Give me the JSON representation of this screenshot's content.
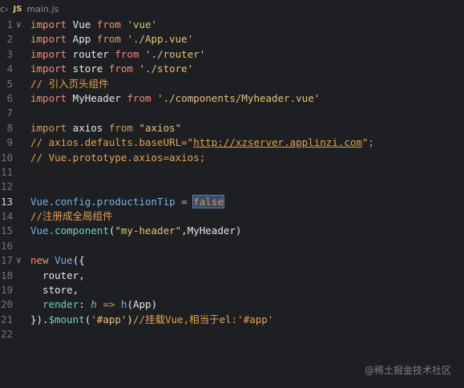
{
  "breadcrumb": {
    "prefix": "c",
    "separator": "›",
    "file_icon": "JS",
    "file_name": "main.js"
  },
  "lines": [
    {
      "n": "1",
      "fold": "∨",
      "parts": [
        [
          "kw",
          "import"
        ],
        [
          "id",
          " Vue "
        ],
        [
          "kw",
          "from"
        ],
        [
          "id",
          " "
        ],
        [
          "str",
          "'vue'"
        ]
      ]
    },
    {
      "n": "2",
      "parts": [
        [
          "kw",
          "import"
        ],
        [
          "id",
          " App "
        ],
        [
          "kw",
          "from"
        ],
        [
          "id",
          " "
        ],
        [
          "str",
          "'./App.vue'"
        ]
      ]
    },
    {
      "n": "3",
      "parts": [
        [
          "kw",
          "import"
        ],
        [
          "id",
          " router "
        ],
        [
          "kw",
          "from"
        ],
        [
          "id",
          " "
        ],
        [
          "str",
          "'./router'"
        ]
      ]
    },
    {
      "n": "4",
      "parts": [
        [
          "kw",
          "import"
        ],
        [
          "id",
          " store "
        ],
        [
          "kw",
          "from"
        ],
        [
          "id",
          " "
        ],
        [
          "str",
          "'./store'"
        ]
      ]
    },
    {
      "n": "5",
      "parts": [
        [
          "com",
          "// 引入页头组件"
        ]
      ]
    },
    {
      "n": "6",
      "parts": [
        [
          "kw",
          "import"
        ],
        [
          "id",
          " MyHeader "
        ],
        [
          "kw",
          "from"
        ],
        [
          "id",
          " "
        ],
        [
          "str",
          "'./components/Myheader.vue'"
        ]
      ]
    },
    {
      "n": "7",
      "parts": []
    },
    {
      "n": "8",
      "parts": [
        [
          "kw2",
          "import"
        ],
        [
          "id",
          " axios "
        ],
        [
          "kw2",
          "from"
        ],
        [
          "id",
          " "
        ],
        [
          "str",
          "\"axios\""
        ]
      ]
    },
    {
      "n": "9",
      "parts": [
        [
          "com",
          "// axios.defaults.baseURL=\""
        ],
        [
          "com url",
          "http://xzserver.applinzi.com"
        ],
        [
          "com",
          "\";"
        ]
      ]
    },
    {
      "n": "10",
      "parts": [
        [
          "com",
          "// Vue.prototype.axios=axios;"
        ]
      ]
    },
    {
      "n": "11",
      "parts": []
    },
    {
      "n": "12",
      "parts": []
    },
    {
      "n": "13",
      "active": true,
      "parts": [
        [
          "fn",
          "Vue"
        ],
        [
          "op",
          "."
        ],
        [
          "fn",
          "config"
        ],
        [
          "op",
          "."
        ],
        [
          "fn",
          "productionTip"
        ],
        [
          "op",
          " = "
        ],
        [
          "kw2 hl",
          "false"
        ]
      ]
    },
    {
      "n": "14",
      "parts": [
        [
          "com",
          "//注册成全局组件"
        ]
      ]
    },
    {
      "n": "15",
      "parts": [
        [
          "fn",
          "Vue"
        ],
        [
          "op",
          "."
        ],
        [
          "prop",
          "component"
        ],
        [
          "id",
          "("
        ],
        [
          "str",
          "\"my-header\""
        ],
        [
          "id",
          ",MyHeader)"
        ]
      ]
    },
    {
      "n": "16",
      "parts": []
    },
    {
      "n": "17",
      "fold": "∨",
      "parts": [
        [
          "kw",
          "new"
        ],
        [
          "id",
          " "
        ],
        [
          "fn",
          "Vue"
        ],
        [
          "id",
          "({"
        ]
      ]
    },
    {
      "n": "18",
      "parts": [
        [
          "id",
          "  router,"
        ]
      ]
    },
    {
      "n": "19",
      "parts": [
        [
          "id",
          "  store,"
        ]
      ]
    },
    {
      "n": "20",
      "parts": [
        [
          "id",
          "  "
        ],
        [
          "prop",
          "render"
        ],
        [
          "id",
          ": "
        ],
        [
          "ital",
          "h"
        ],
        [
          "id",
          " "
        ],
        [
          "kw2",
          "=>"
        ],
        [
          "id",
          " "
        ],
        [
          "fn",
          "h"
        ],
        [
          "id",
          "(App)"
        ]
      ]
    },
    {
      "n": "21",
      "parts": [
        [
          "id",
          "})."
        ],
        [
          "prop",
          "$mount"
        ],
        [
          "id",
          "("
        ],
        [
          "str",
          "'#app'"
        ],
        [
          "id",
          ")"
        ],
        [
          "com",
          "//挂载Vue,相当于el:'#app'"
        ]
      ]
    },
    {
      "n": "22",
      "parts": []
    }
  ],
  "watermark": "@稀土掘金技术社区",
  "colors": {
    "background": "#1e1f22",
    "keyword": "#f28a7b",
    "string": "#e5c07b",
    "comment": "#e3a24f",
    "selection": "#3a4a66"
  }
}
